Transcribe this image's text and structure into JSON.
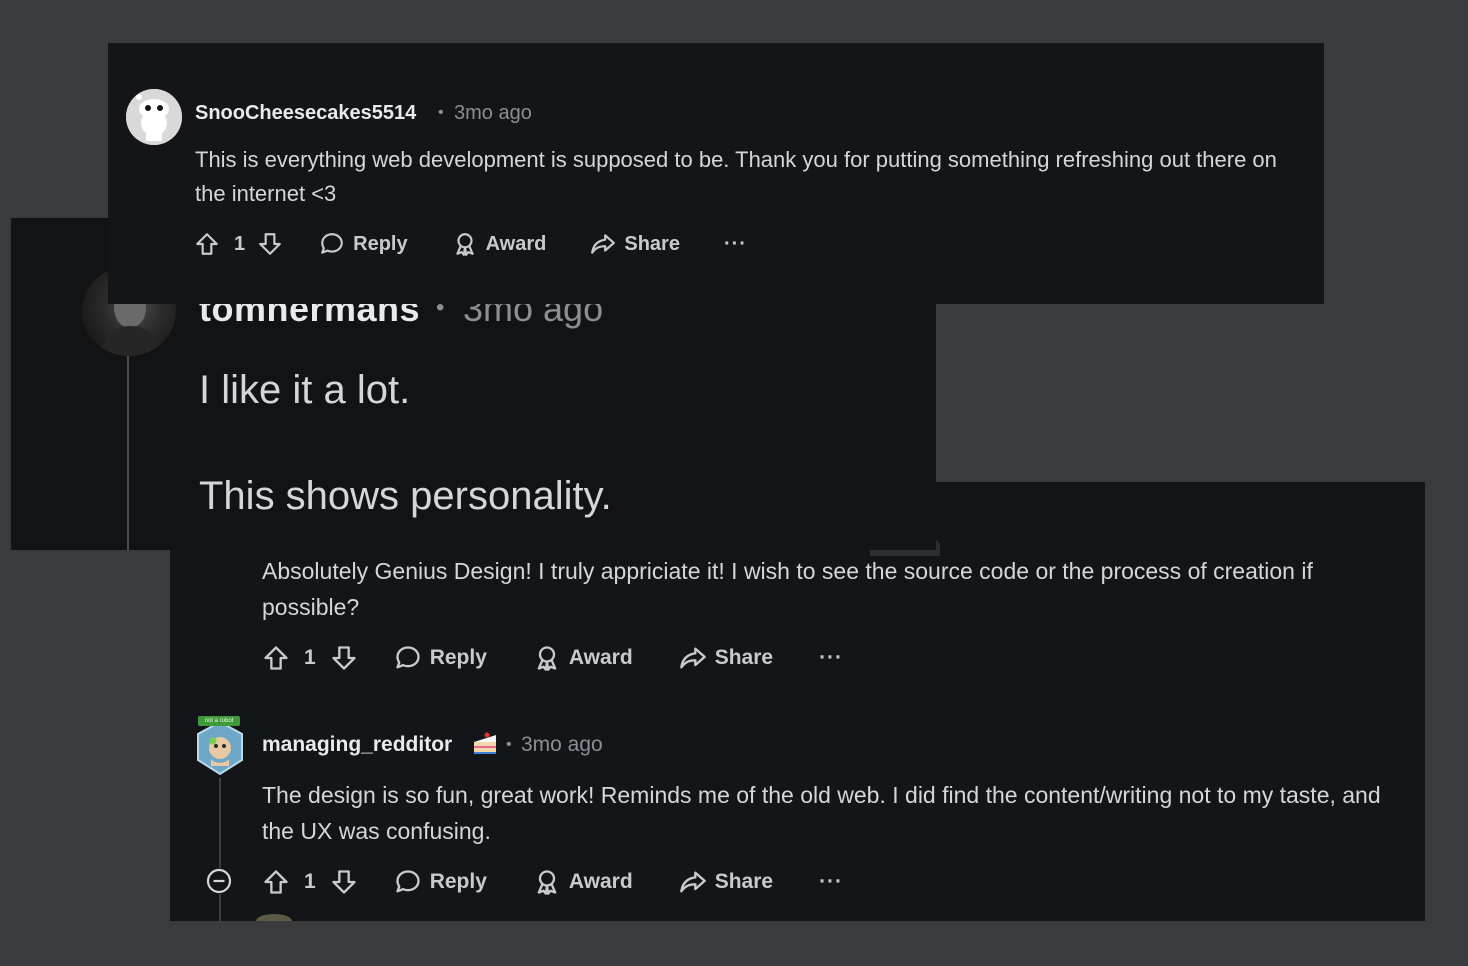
{
  "comments": [
    {
      "username": "SnooCheesecakes5514",
      "separator": "•",
      "time": "3mo ago",
      "body": "This is everything web development is supposed to be. Thank you for putting something refreshing out there on the internet <3",
      "votes": "1",
      "actions": {
        "reply": "Reply",
        "award": "Award",
        "share": "Share",
        "more": "···"
      }
    },
    {
      "username": "tomhermans",
      "separator": "•",
      "time": "3mo ago",
      "body_line1": "I like it a lot.",
      "body_line2": "This shows personality."
    },
    {
      "body": "Absolutely Genius Design! I truly appriciate it! I wish to see the source code or the process of creation if possible?",
      "votes": "1",
      "actions": {
        "reply": "Reply",
        "award": "Award",
        "share": "Share",
        "more": "···"
      }
    },
    {
      "username": "managing_redditor",
      "flair_icon": "cake-icon",
      "avatar_badge": "not a robot",
      "separator": "•",
      "time": "3mo ago",
      "body": "The design is so fun, great work! Reminds me of the old web. I did find the content/writing not to my taste, and the UX was confusing.",
      "votes": "1",
      "actions": {
        "reply": "Reply",
        "award": "Award",
        "share": "Share",
        "more": "···"
      }
    }
  ],
  "colors": {
    "page_bg": "#3a3b3d",
    "card_bg": "#131518",
    "text": "#d4d7da",
    "muted": "#8a8f96"
  }
}
